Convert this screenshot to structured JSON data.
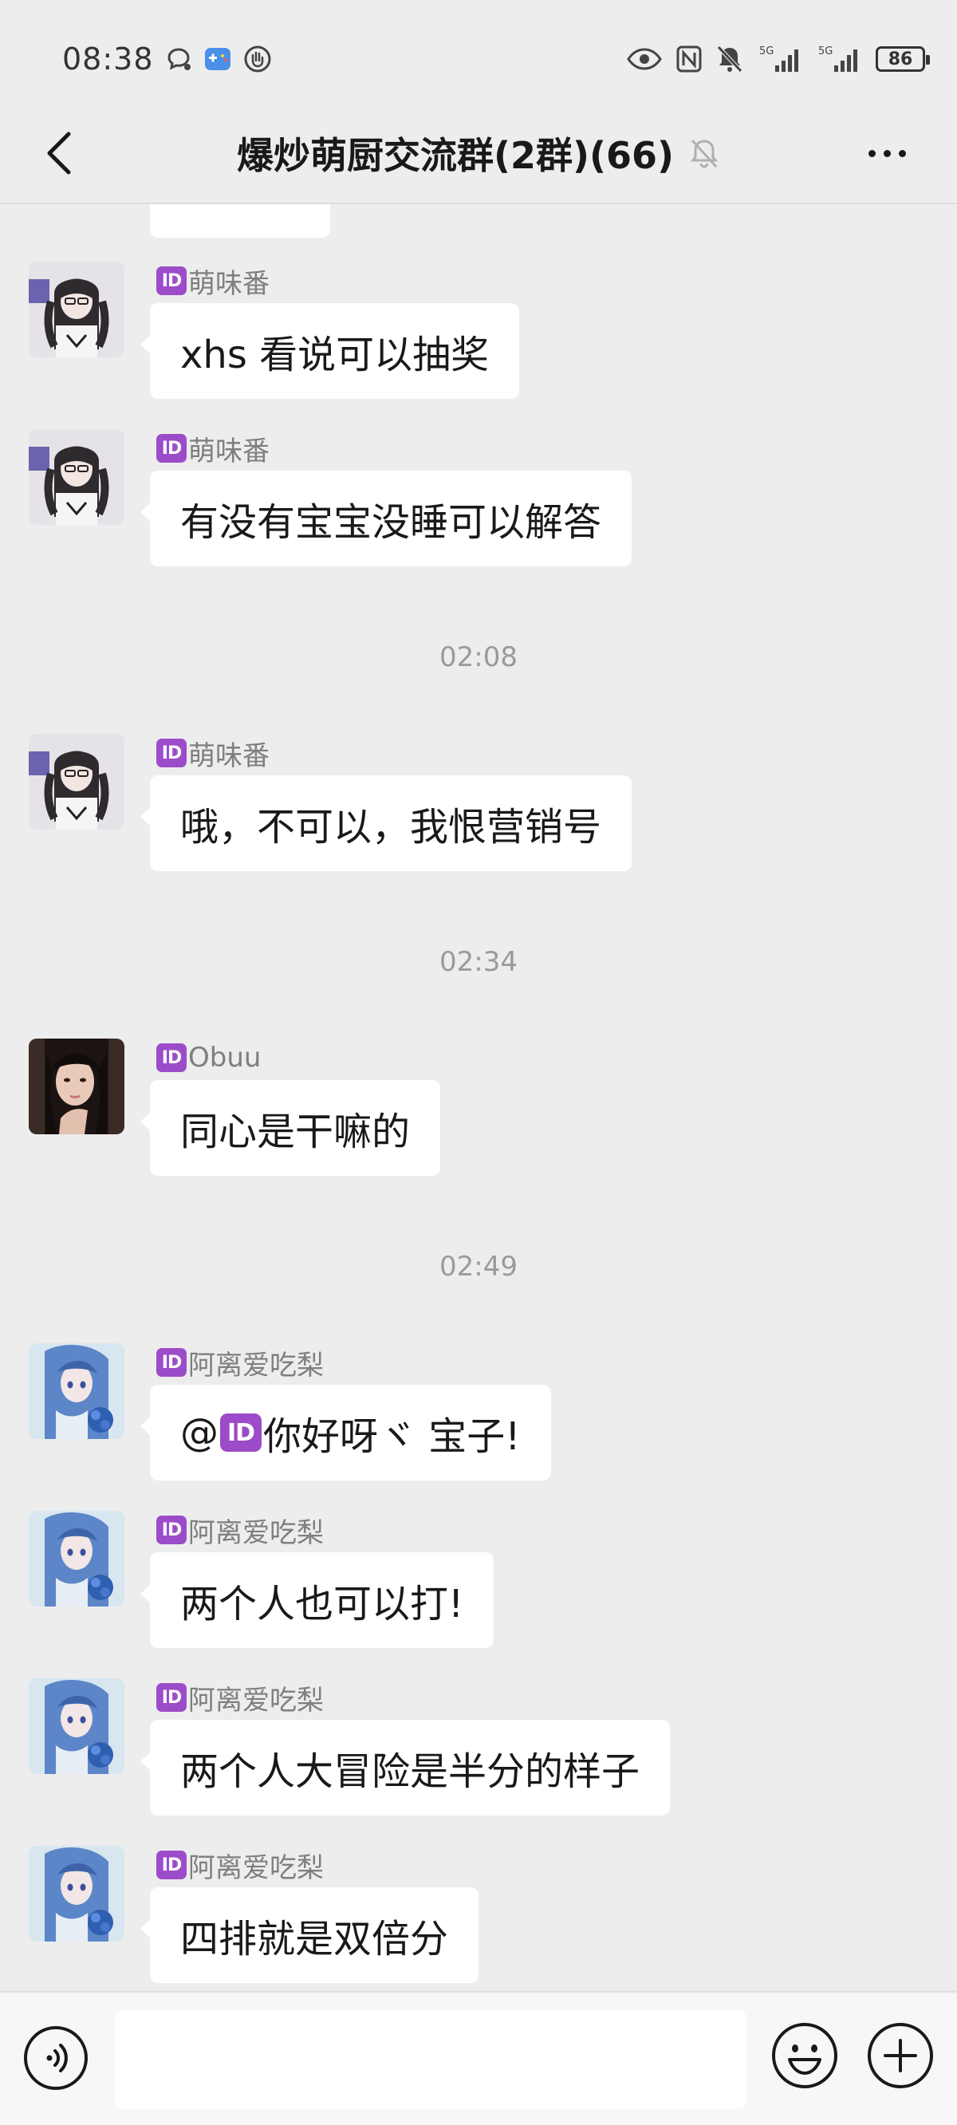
{
  "status_bar": {
    "time": "08:38",
    "battery": "86",
    "signal_1": "5G",
    "signal_2": "5G"
  },
  "header": {
    "title": "爆炒萌厨交流群(2群)(66)",
    "muted": true
  },
  "messages": [
    {
      "type": "text",
      "sender": "萌味番",
      "text": "xhs 看说可以抽奖",
      "avatar": "anime-girl-twintails"
    },
    {
      "type": "text",
      "sender": "萌味番",
      "text": "有没有宝宝没睡可以解答",
      "avatar": "anime-girl-twintails"
    },
    {
      "type": "time",
      "text": "02:08"
    },
    {
      "type": "text",
      "sender": "萌味番",
      "text": "哦，不可以，我恨营销号",
      "avatar": "anime-girl-twintails"
    },
    {
      "type": "time",
      "text": "02:34"
    },
    {
      "type": "text",
      "sender": "Obuu",
      "text": "同心是干嘛的",
      "avatar": "girl-photo"
    },
    {
      "type": "time",
      "text": "02:49"
    },
    {
      "type": "text",
      "sender": "阿离爱吃梨",
      "text_prefix": "@",
      "text_suffix": "你好呀ヾ 宝子!",
      "avatar": "anime-blue-hair"
    },
    {
      "type": "text",
      "sender": "阿离爱吃梨",
      "text": "两个人也可以打!",
      "avatar": "anime-blue-hair"
    },
    {
      "type": "text",
      "sender": "阿离爱吃梨",
      "text": "两个人大冒险是半分的样子",
      "avatar": "anime-blue-hair"
    },
    {
      "type": "text",
      "sender": "阿离爱吃梨",
      "text": "四排就是双倍分",
      "avatar": "anime-blue-hair"
    }
  ],
  "badge_label": "ID",
  "colors": {
    "background": "#ededed",
    "bubble": "#ffffff",
    "id_badge": "#9c4cc9"
  },
  "input_bar": {
    "voice_icon": "voice-icon",
    "emoji_icon": "emoji-icon",
    "plus_icon": "plus-icon"
  }
}
